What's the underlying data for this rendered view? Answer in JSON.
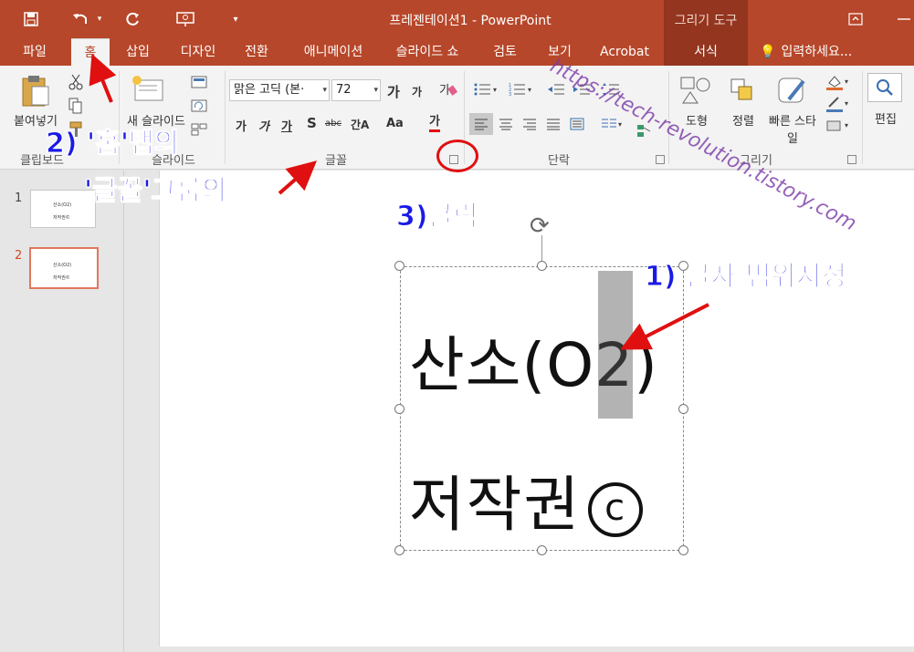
{
  "titlebar": {
    "title": "프레젠테이션1 - PowerPoint",
    "contextual_group": "그리기 도구"
  },
  "tabs": [
    "파일",
    "홈",
    "삽입",
    "디자인",
    "전환",
    "애니메이션",
    "슬라이드 쇼",
    "검토",
    "보기",
    "Acrobat",
    "서식"
  ],
  "tellme": "입력하세요...",
  "ribbon": {
    "clipboard": {
      "paste": "붙여넣기",
      "group": "클립보드"
    },
    "slides": {
      "new_slide": "새 슬라이드",
      "group": "슬라이드"
    },
    "font": {
      "name": "맑은 고딕 (본·",
      "size": "72",
      "grow": "가",
      "shrink": "가",
      "bold": "가",
      "italic": "가",
      "underline": "가",
      "shadow": "S",
      "strike": "abc",
      "spacing": "간A",
      "case": "Aa",
      "color": "가",
      "group": "글꼴"
    },
    "paragraph": {
      "group": "단락"
    },
    "drawing": {
      "arrange": "정렬",
      "shapes": "도형",
      "quickstyles": "빠른 스타일",
      "group": "그리기"
    },
    "editing": {
      "label": "편집"
    }
  },
  "slides_pane": [
    {
      "num": "1",
      "l1": "산소(O2)",
      "l2": "저작권©"
    },
    {
      "num": "2",
      "l1": "산소(O2)",
      "l2": "저작권©"
    }
  ],
  "slide": {
    "line1_before": "산소(O",
    "line1_sel": "2",
    "line1_after": ")",
    "line2_text": "저작권",
    "line2_symbol": "c"
  },
  "annotations": {
    "step1": "1) 글자 범위지정",
    "step2a": "2) '홈'탭의",
    "step2b": "'글꼴'그룹의",
    "step3": "3)클릭",
    "watermark": "https://tech-revolution.tistory.com"
  },
  "colors": {
    "titlebar": "#b7472a",
    "contextual": "#93351f",
    "annotation_text": "#1a1ae6",
    "annotation_arrow": "#e01010",
    "selection_highlight": "#b3b3b3"
  }
}
